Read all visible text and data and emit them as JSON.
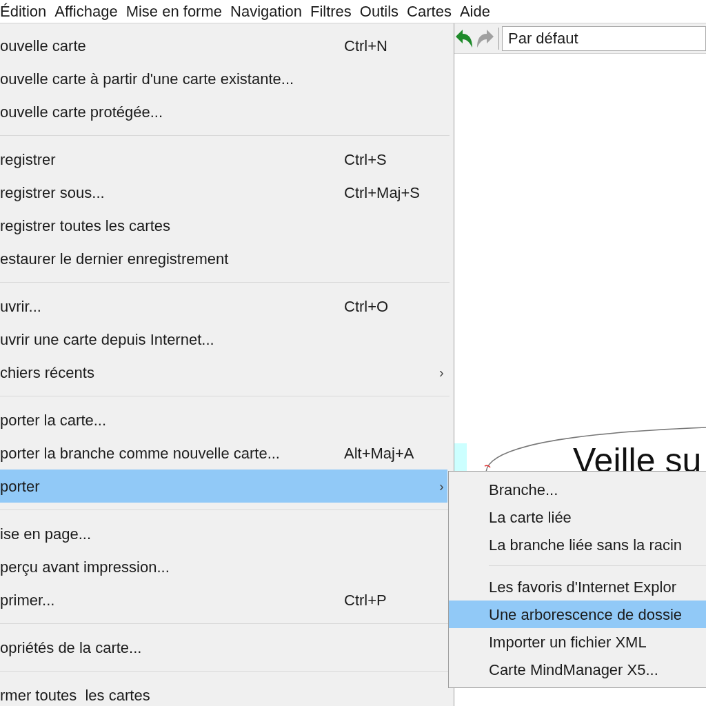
{
  "menubar": {
    "items": [
      {
        "label": "Édition"
      },
      {
        "label": "Affichage"
      },
      {
        "label": "Mise en forme"
      },
      {
        "label": "Navigation"
      },
      {
        "label": "Filtres"
      },
      {
        "label": "Outils"
      },
      {
        "label": "Cartes"
      },
      {
        "label": "Aide"
      }
    ]
  },
  "file_menu": {
    "items": [
      {
        "kind": "item",
        "label": "ouvelle carte",
        "shortcut": "Ctrl+N",
        "selected": false
      },
      {
        "kind": "item",
        "label": "ouvelle carte à partir d'une carte existante...",
        "selected": false
      },
      {
        "kind": "item",
        "label": "ouvelle carte protégée...",
        "selected": false
      },
      {
        "kind": "separator"
      },
      {
        "kind": "item",
        "label": "registrer",
        "shortcut": "Ctrl+S",
        "selected": false
      },
      {
        "kind": "item",
        "label": "registrer sous...",
        "shortcut": "Ctrl+Maj+S",
        "selected": false
      },
      {
        "kind": "item",
        "label": "registrer toutes les cartes",
        "selected": false
      },
      {
        "kind": "item",
        "label": "estaurer le dernier enregistrement",
        "selected": false
      },
      {
        "kind": "separator"
      },
      {
        "kind": "item",
        "label": "uvrir...",
        "shortcut": "Ctrl+O",
        "selected": false
      },
      {
        "kind": "item",
        "label": "uvrir une carte depuis Internet...",
        "selected": false
      },
      {
        "kind": "item",
        "label": "chiers récents",
        "arrow": "›",
        "selected": false
      },
      {
        "kind": "separator"
      },
      {
        "kind": "item",
        "label": "porter la carte...",
        "selected": false
      },
      {
        "kind": "item",
        "label": "porter la branche comme nouvelle carte...",
        "shortcut": "Alt+Maj+A",
        "selected": false
      },
      {
        "kind": "item",
        "label": "porter",
        "arrow": "›",
        "selected": true
      },
      {
        "kind": "separator"
      },
      {
        "kind": "item",
        "label": "ise en page...",
        "selected": false
      },
      {
        "kind": "item",
        "label": "perçu avant impression...",
        "selected": false
      },
      {
        "kind": "item",
        "label": "primer...",
        "shortcut": "Ctrl+P",
        "selected": false
      },
      {
        "kind": "separator"
      },
      {
        "kind": "item",
        "label": "opriétés de la carte...",
        "selected": false
      },
      {
        "kind": "separator"
      },
      {
        "kind": "item",
        "label": "rmer toutes  les cartes",
        "selected": false
      }
    ]
  },
  "toolbar": {
    "style_box": {
      "value": "Par défaut"
    }
  },
  "canvas": {
    "node": {
      "text": "Veille su"
    }
  },
  "submenu": {
    "items": [
      {
        "kind": "item",
        "label": "Branche...",
        "selected": false
      },
      {
        "kind": "item",
        "label": "La carte liée",
        "selected": false
      },
      {
        "kind": "item",
        "label": "La branche liée sans la racin",
        "selected": false
      },
      {
        "kind": "separator"
      },
      {
        "kind": "item",
        "label": "Les favoris d'Internet Explor",
        "selected": false
      },
      {
        "kind": "item",
        "label": "Une arborescence de dossie",
        "selected": true
      },
      {
        "kind": "item",
        "label": "Importer un fichier XML",
        "selected": false
      },
      {
        "kind": "item",
        "label": "Carte MindManager X5...",
        "selected": false
      }
    ]
  }
}
